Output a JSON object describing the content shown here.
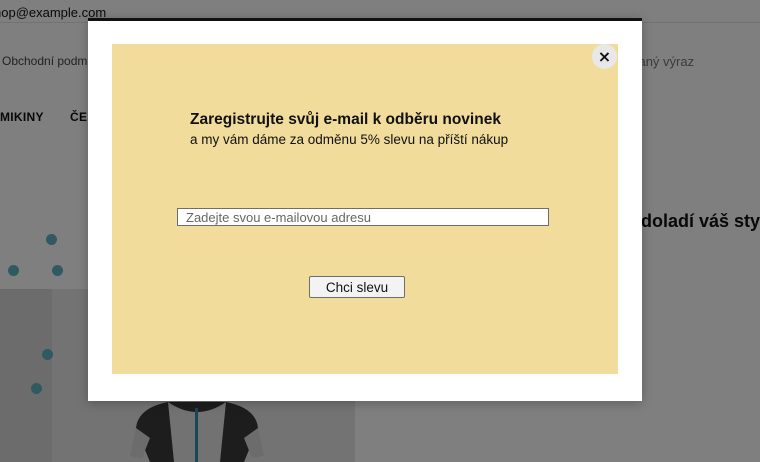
{
  "background": {
    "topbar": {
      "email": "hop@example.com"
    },
    "header": {
      "terms_link": "Obchodní podm",
      "search_placeholder": "edaný výraz"
    },
    "nav": {
      "items": [
        {
          "label": "MIKINY"
        },
        {
          "label": "ČE"
        }
      ]
    },
    "content": {
      "promo_heading": "ě doladí váš sty"
    }
  },
  "modal": {
    "close_label": "×",
    "title": "Zaregistrujte svůj e-mail k odběru novinek",
    "subtitle": "a my vám dáme za odměnu 5% slevu na příští nákup",
    "email_input": {
      "placeholder": "Zadejte svou e-mailovou adresu",
      "value": ""
    },
    "submit_label": "Chci slevu"
  },
  "colors": {
    "panel_background": "#f1dc9c",
    "overlay": "rgba(0,0,0,0.5)",
    "accent_dots": "#5fb4c2"
  }
}
